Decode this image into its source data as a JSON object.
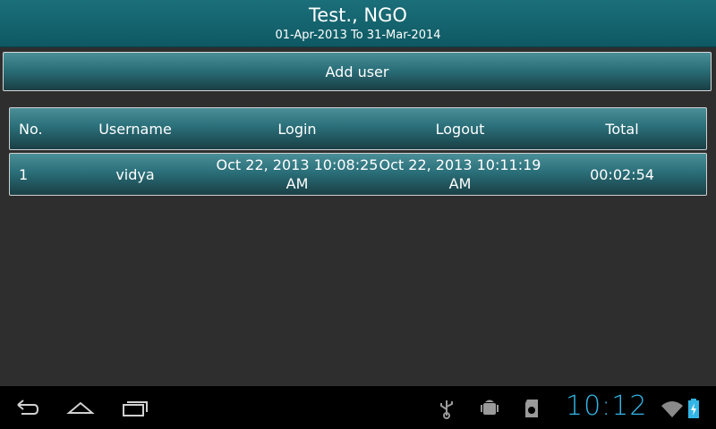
{
  "header": {
    "title": "Test., NGO",
    "subtitle": "01-Apr-2013 To 31-Mar-2014"
  },
  "actions": {
    "add_user_label": "Add user"
  },
  "table": {
    "columns": [
      "No.",
      "Username",
      "Login",
      "Logout",
      "Total"
    ],
    "rows": [
      {
        "no": "1",
        "username": "vidya",
        "login": "Oct 22, 2013 10:08:25 AM",
        "logout": "Oct 22, 2013 10:11:19 AM",
        "total": "00:02:54"
      }
    ]
  },
  "navbar": {
    "icons": [
      "back-icon",
      "home-icon",
      "recent-apps-icon"
    ]
  },
  "status_bar": {
    "icons": [
      "usb-icon",
      "android-debug-icon",
      "sd-card-icon",
      "wifi-icon",
      "battery-icon"
    ],
    "clock": "10:12",
    "clock_color": "#33b5e5"
  },
  "colors": {
    "accent": "#1b6f7a",
    "background": "#2e2e2e"
  }
}
